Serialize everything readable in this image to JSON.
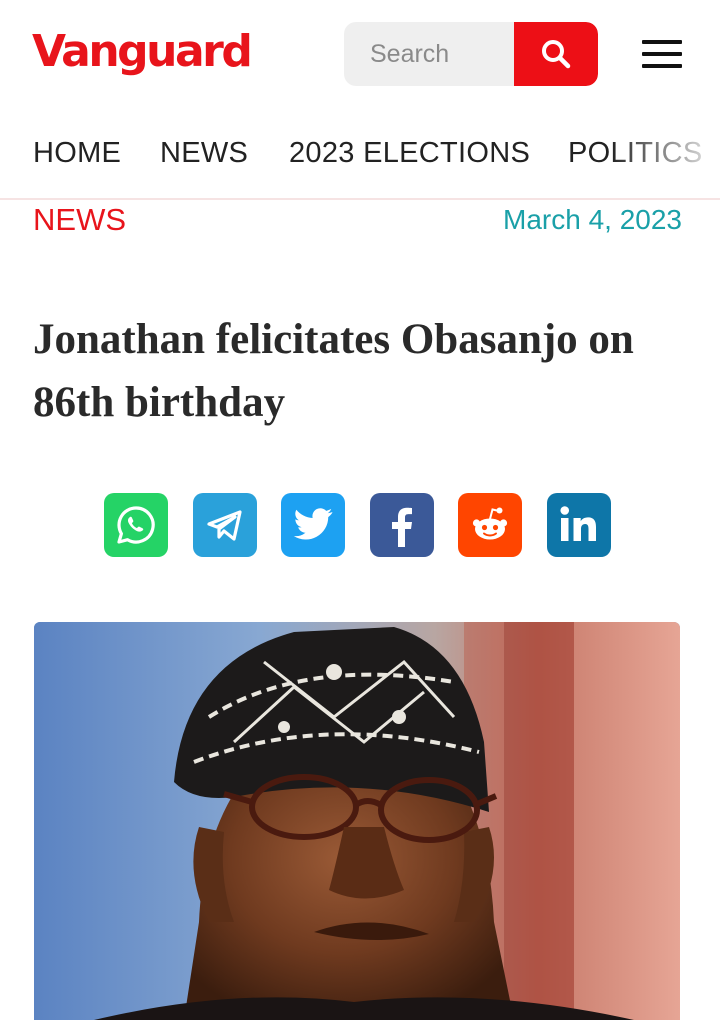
{
  "brand": {
    "name": "Vanguard",
    "color": "#e8141b"
  },
  "search": {
    "placeholder": "Search",
    "icon": "search-icon"
  },
  "menu": {
    "icon": "hamburger-menu-icon"
  },
  "nav": {
    "items": [
      "HOME",
      "NEWS",
      "2023 ELECTIONS",
      "POLITICS"
    ]
  },
  "article": {
    "category": "NEWS",
    "date": "March 4, 2023",
    "title": "Jonathan felicitates Obasanjo on 86th birthday"
  },
  "share": [
    {
      "name": "whatsapp",
      "icon": "whatsapp-icon",
      "color": "#25d366"
    },
    {
      "name": "telegram",
      "icon": "telegram-icon",
      "color": "#2aa1da"
    },
    {
      "name": "twitter",
      "icon": "twitter-icon",
      "color": "#1da1f2"
    },
    {
      "name": "facebook",
      "icon": "facebook-icon",
      "color": "#3b5998"
    },
    {
      "name": "reddit",
      "icon": "reddit-icon",
      "color": "#ff4500"
    },
    {
      "name": "linkedin",
      "icon": "linkedin-icon",
      "color": "#0e76a8"
    }
  ],
  "image": {
    "subject": "article-photo"
  }
}
